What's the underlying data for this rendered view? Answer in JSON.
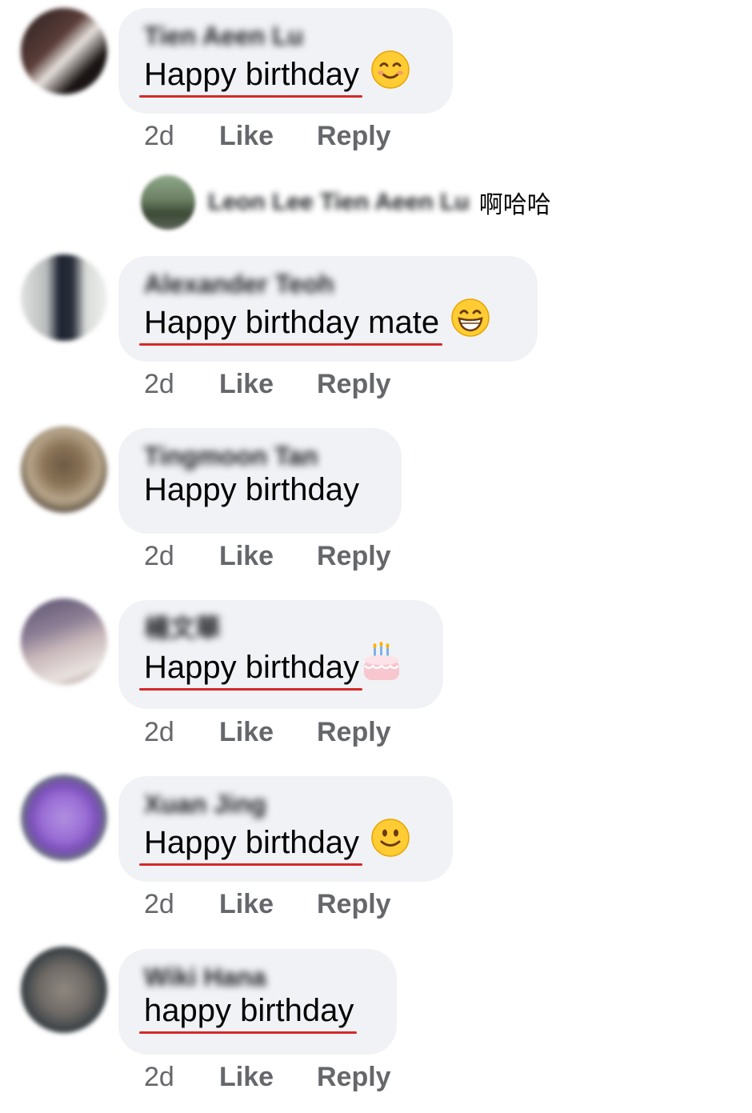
{
  "comments": [
    {
      "author": "Tien Aeen Lu",
      "text": "Happy birthday",
      "emoji": "smiling-eyes-emoji",
      "misspelled": true,
      "time": "2d",
      "like": "Like",
      "reply": "Reply"
    },
    {
      "author": "Alexander Teoh",
      "text": "Happy birthday mate",
      "emoji": "grinning-emoji",
      "misspelled": true,
      "time": "2d",
      "like": "Like",
      "reply": "Reply"
    },
    {
      "author": "Tingmoon Tan",
      "text": "Happy birthday",
      "emoji": "",
      "misspelled": false,
      "time": "2d",
      "like": "Like",
      "reply": "Reply"
    },
    {
      "author": "楊文華",
      "text": "Happy birthday",
      "emoji": "birthday-cake-emoji",
      "misspelled": true,
      "time": "2d",
      "like": "Like",
      "reply": "Reply"
    },
    {
      "author": "Xuan Jing",
      "text": "Happy birthday",
      "emoji": "slight-smile-emoji",
      "misspelled": true,
      "time": "2d",
      "like": "Like",
      "reply": "Reply"
    },
    {
      "author": "Wiki Hana",
      "text": "happy birthday",
      "emoji": "",
      "misspelled": true,
      "time": "2d",
      "like": "Like",
      "reply": "Reply"
    }
  ],
  "reply_preview": {
    "author": "Leon Lee Tien Aeen Lu",
    "text": "啊哈哈"
  },
  "colors": {
    "bubble": "#f0f2f5",
    "meta": "#65676b",
    "spellcheck": "#d62828"
  }
}
